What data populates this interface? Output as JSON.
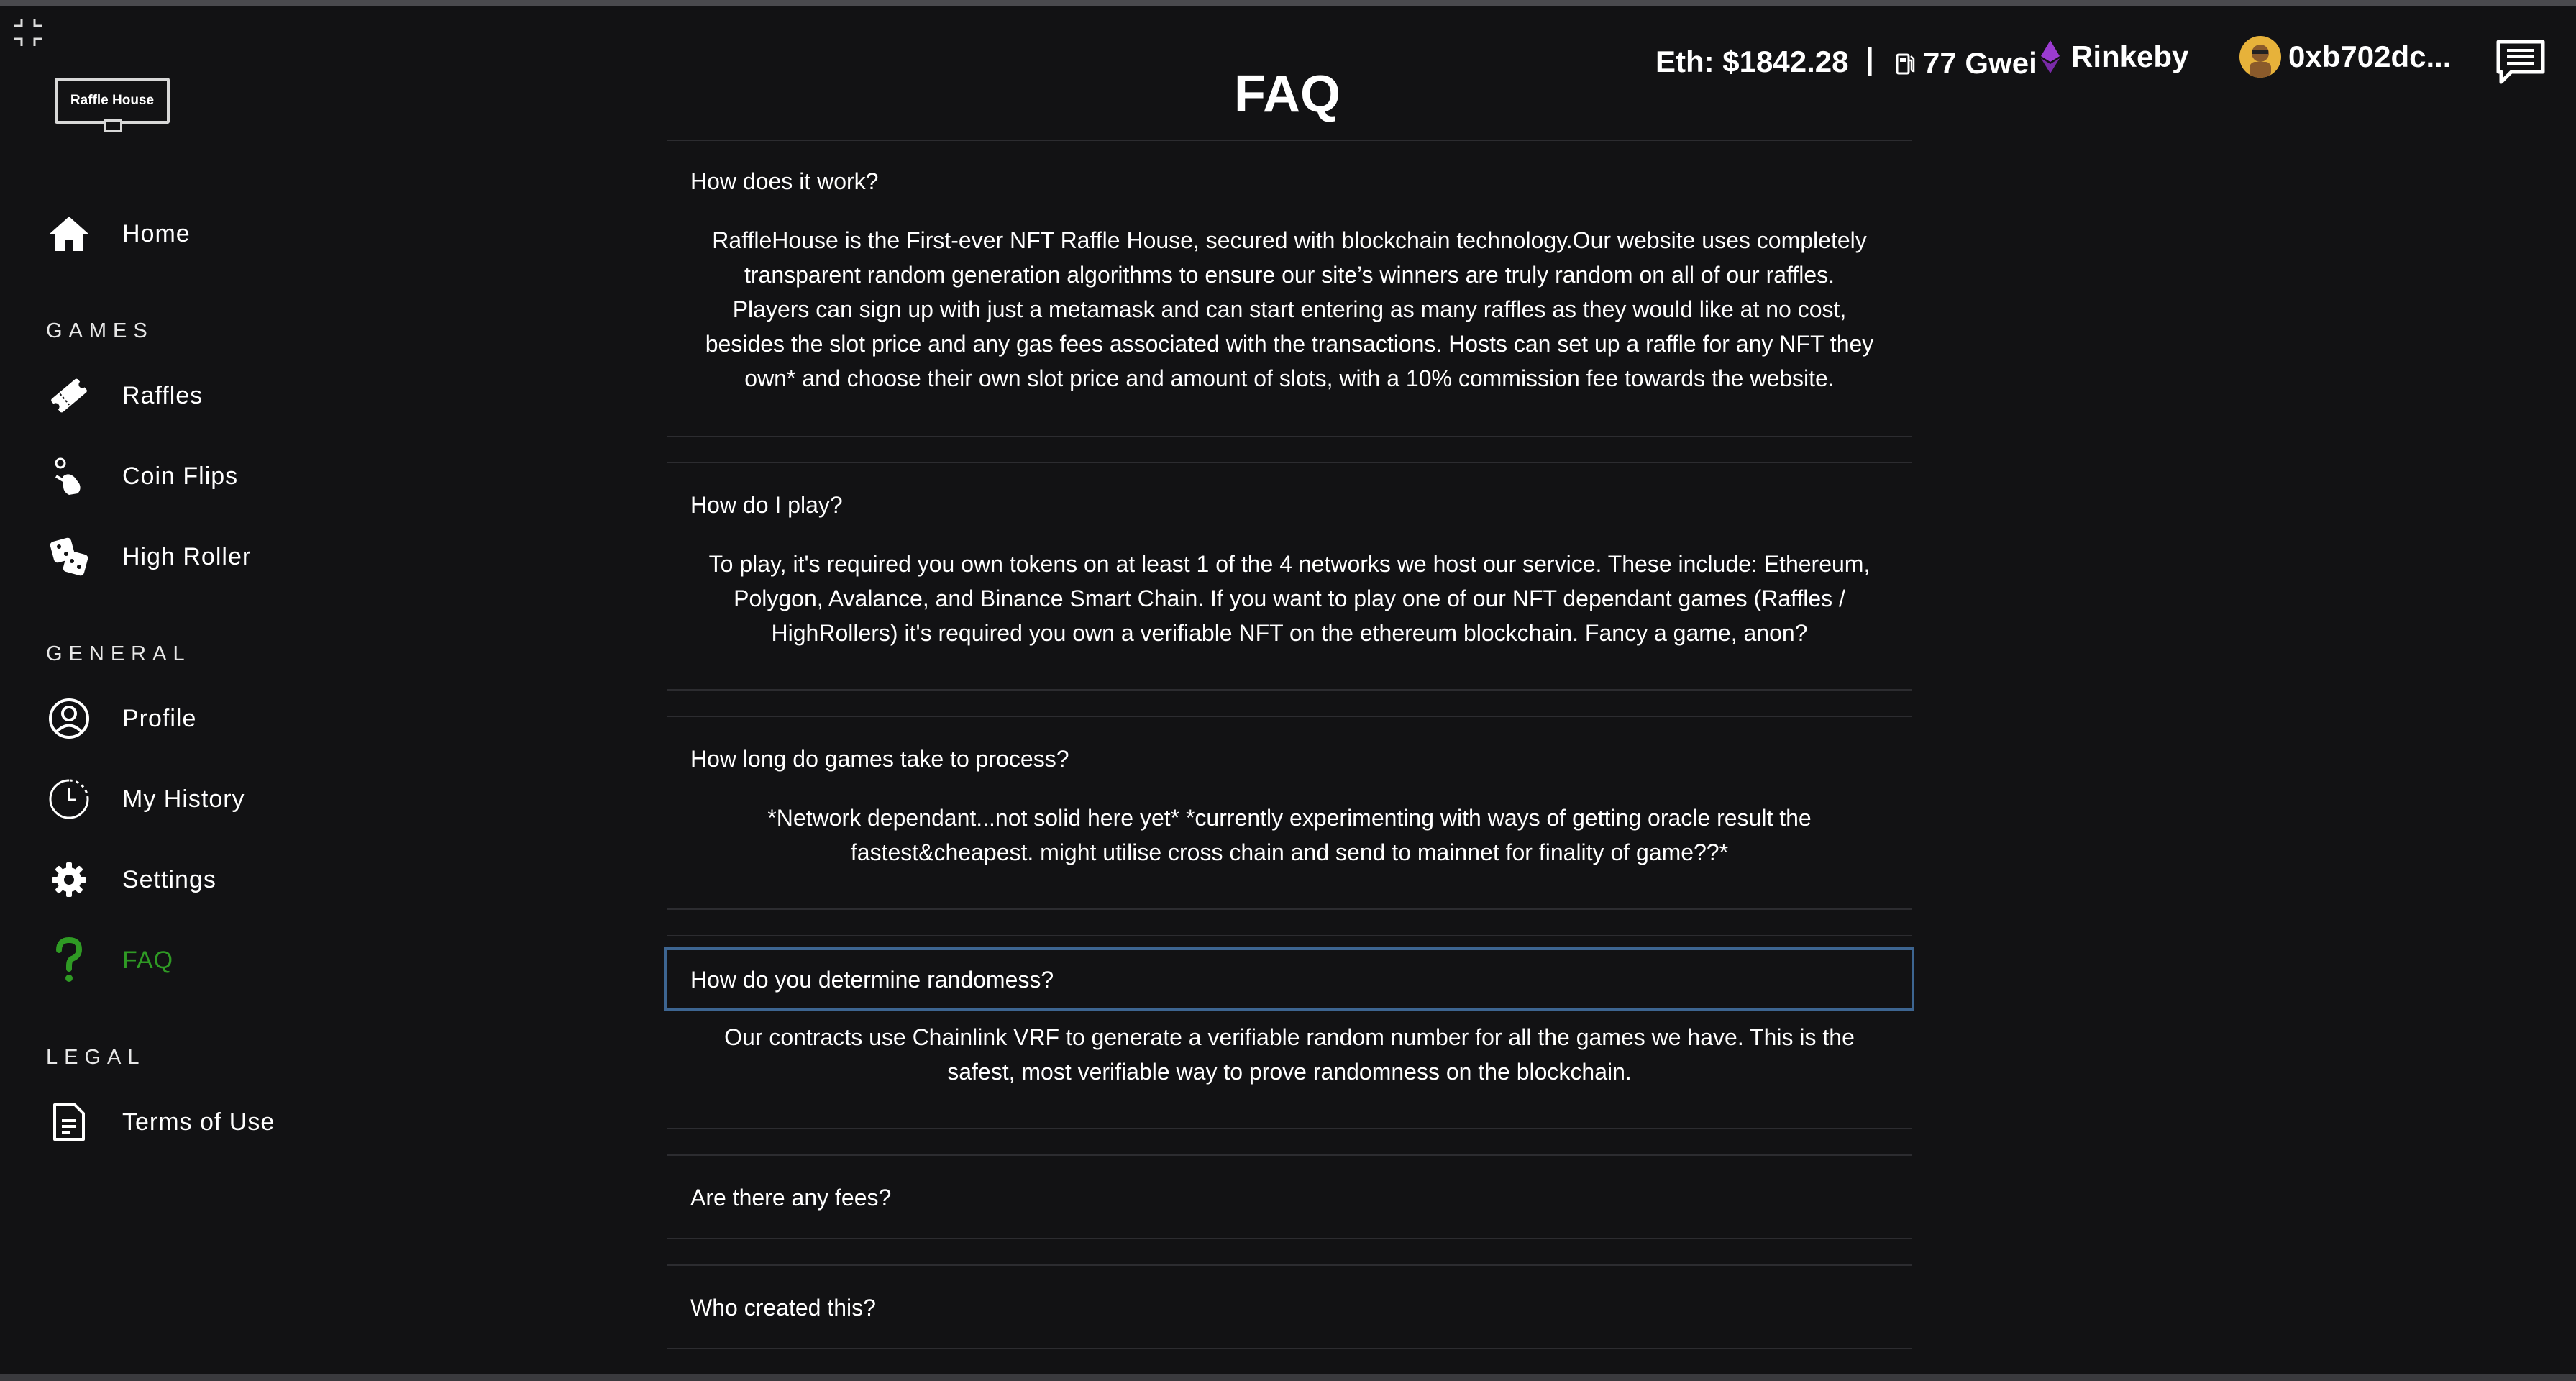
{
  "app": {
    "logo_text": "Raffle House",
    "accent_color": "#2f9a24",
    "focus_color": "#3d6591"
  },
  "sidebar": {
    "home": "Home",
    "games_header": "GAMES",
    "games": [
      {
        "label": "Raffles",
        "icon": "ticket-icon"
      },
      {
        "label": "Coin Flips",
        "icon": "coin-flip-icon"
      },
      {
        "label": "High Roller",
        "icon": "dice-icon"
      }
    ],
    "general_header": "GENERAL",
    "general": [
      {
        "label": "Profile",
        "icon": "user-circle-icon"
      },
      {
        "label": "My History",
        "icon": "clock-history-icon"
      },
      {
        "label": "Settings",
        "icon": "gear-icon"
      },
      {
        "label": "FAQ",
        "icon": "question-icon"
      }
    ],
    "legal_header": "LEGAL",
    "legal": [
      {
        "label": "Terms of Use",
        "icon": "document-icon"
      }
    ]
  },
  "header": {
    "eth_price": "Eth: $1842.28",
    "separator": "|",
    "gas": "77 Gwei",
    "network": "Rinkeby",
    "wallet": "0xb702dc..."
  },
  "page": {
    "title": "FAQ"
  },
  "faq": [
    {
      "question": "How does it work?",
      "answer_lines": [
        "RaffleHouse is the First-ever NFT Raffle House, secured with blockchain technology.Our website uses completely",
        "transparent random generation algorithms to ensure our site’s winners are truly random on all of our raffles.",
        "Players can sign up with just a metamask and can start entering as many raffles as they would like at no cost,",
        "besides the slot price and any gas fees associated with the transactions. Hosts can set up a raffle for any NFT they",
        "own* and choose their own slot price and amount of slots, with a 10% commission fee towards the website."
      ]
    },
    {
      "question": "How do I play?",
      "answer_lines": [
        "To play, it's required you own tokens on at least 1 of the 4 networks we host our service. These include: Ethereum,",
        "Polygon, Avalance, and Binance Smart Chain. If you want to play one of our NFT dependant games (Raffles /",
        "HighRollers) it's required you own a verifiable NFT on the ethereum blockchain. Fancy a game, anon?"
      ]
    },
    {
      "question": "How long do games take to process?",
      "answer_lines": [
        "*Network dependant...not solid here yet* *currently experimenting with ways of getting oracle result the",
        "fastest&cheapest. might utilise cross chain and send to mainnet for finality of game??*"
      ]
    },
    {
      "question": "How do you determine randomess?",
      "answer_lines": [
        "Our contracts use Chainlink VRF to generate a verifiable random number for all the games we have. This is the",
        "safest, most verifiable way to prove randomness on the blockchain."
      ]
    },
    {
      "question": "Are there any fees?"
    },
    {
      "question": "Who created this?"
    }
  ]
}
